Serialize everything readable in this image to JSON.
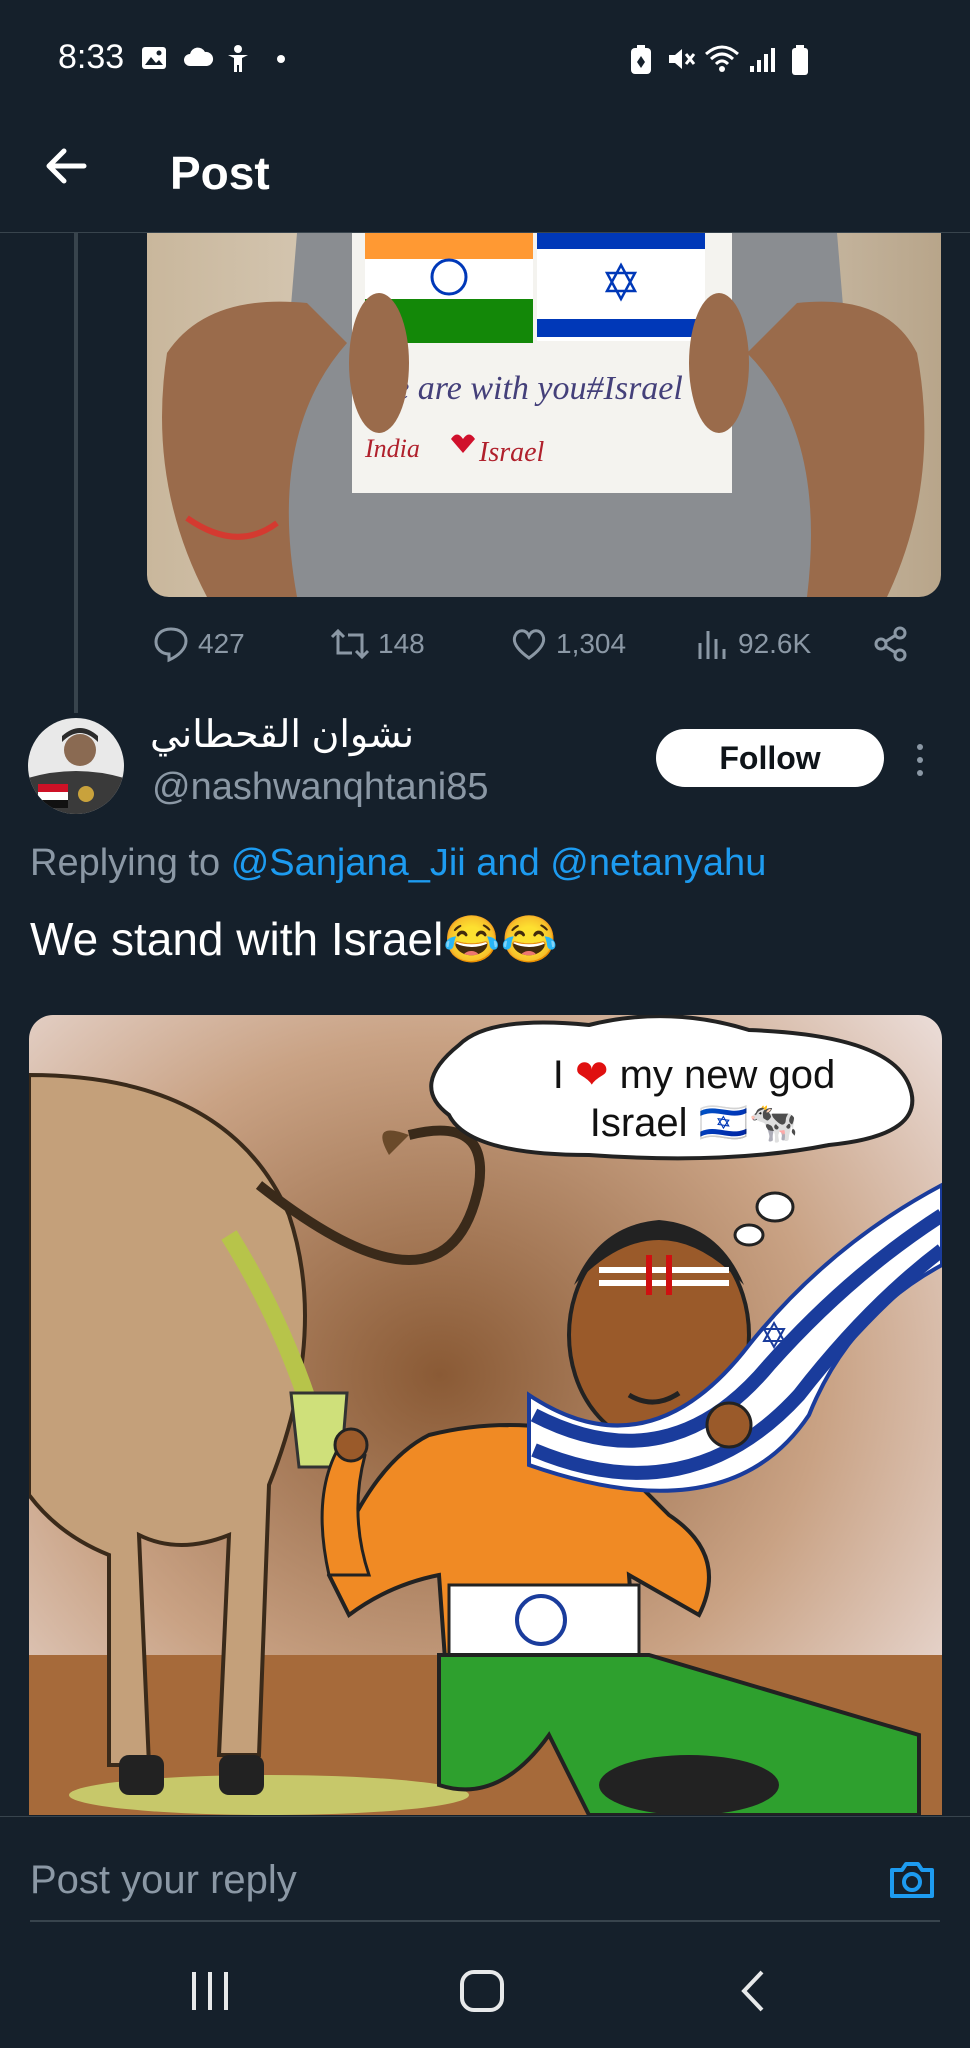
{
  "status_bar": {
    "time": "8:33",
    "left_icons": [
      "gallery-icon",
      "cloud-icon",
      "accessibility-icon",
      "dot-icon"
    ],
    "right_icons": [
      "battery-saver-icon",
      "mute-icon",
      "wifi-icon",
      "signal-icon",
      "battery-icon"
    ]
  },
  "header": {
    "title": "Post",
    "back_icon": "arrow-left-icon"
  },
  "parent_post": {
    "image_description_colors": [
      "#ff9933",
      "#138808",
      "#0038b8"
    ],
    "actions": {
      "replies": "427",
      "reposts": "148",
      "likes": "1,304",
      "views": "92.6K"
    }
  },
  "reply_post": {
    "display_name": "نشوان القحطاني",
    "handle": "@nashwanqhtani85",
    "follow_label": "Follow",
    "replying_prefix": "Replying to",
    "replying_to": "@Sanjana_Jii and @netanyahu",
    "text": "We stand with Israel😂😂",
    "meme": {
      "bubble_line1": "I",
      "bubble_line1b": "my new god",
      "bubble_line2": "Israel 🇮🇱🐄"
    }
  },
  "composer": {
    "placeholder": "Post your reply",
    "camera_icon": "camera-icon"
  },
  "nav_bar": {
    "buttons": [
      "recents-icon",
      "home-icon",
      "back-icon"
    ]
  },
  "colors": {
    "background": "#15202b",
    "accent": "#1d9bf0",
    "muted": "#8b98a5",
    "divider": "#38444d"
  }
}
